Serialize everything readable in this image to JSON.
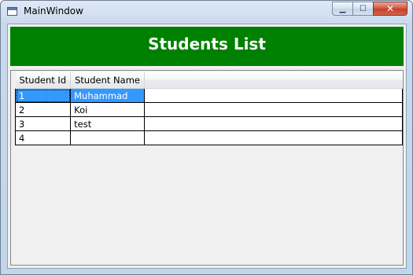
{
  "window": {
    "title": "MainWindow",
    "minimize_glyph": "▁",
    "maximize_glyph": "☐",
    "close_glyph": "✕"
  },
  "header": {
    "title": "Students List",
    "background": "#008000"
  },
  "grid": {
    "columns": [
      "Student Id",
      "Student Name"
    ],
    "rows": [
      {
        "id": "1",
        "name": "Muhammad"
      },
      {
        "id": "2",
        "name": "Koi"
      },
      {
        "id": "3",
        "name": "test"
      },
      {
        "id": "4",
        "name": ""
      }
    ],
    "selection_color": "#3399ff"
  }
}
